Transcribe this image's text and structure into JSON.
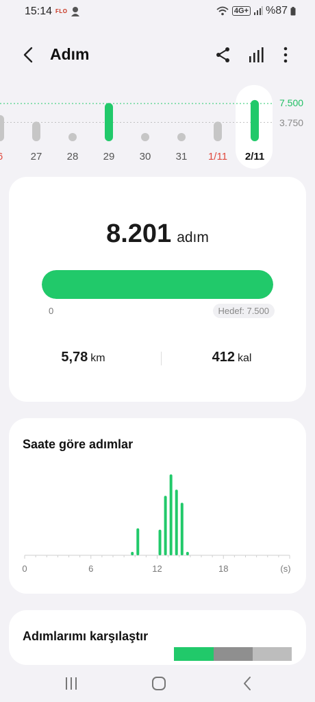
{
  "status_bar": {
    "time": "15:14",
    "carrier_badge": "FLO",
    "battery": "%87",
    "network": "4G+"
  },
  "header": {
    "title": "Adım",
    "back_icon": "chevron-left-icon",
    "actions": [
      "share-icon",
      "bar-chart-icon",
      "more-vertical-icon"
    ]
  },
  "date_strip": {
    "goal_line_label": "7.500",
    "half_line_label": "3.750",
    "days": [
      {
        "label": "6",
        "steps": 5200,
        "color": "#c6c6c6",
        "red": true,
        "selected": false
      },
      {
        "label": "27",
        "steps": 3900,
        "color": "#c6c6c6",
        "red": false,
        "selected": false
      },
      {
        "label": "28",
        "steps": 0,
        "color": "#c6c6c6",
        "red": false,
        "selected": false
      },
      {
        "label": "29",
        "steps": 7600,
        "color": "#21c96a",
        "red": false,
        "selected": false
      },
      {
        "label": "30",
        "steps": 0,
        "color": "#c6c6c6",
        "red": false,
        "selected": false
      },
      {
        "label": "31",
        "steps": 0,
        "color": "#c6c6c6",
        "red": false,
        "selected": false
      },
      {
        "label": "1/11",
        "steps": 3900,
        "color": "#c6c6c6",
        "red": true,
        "selected": false
      },
      {
        "label": "2/11",
        "steps": 8201,
        "color": "#21c96a",
        "red": false,
        "selected": true
      }
    ]
  },
  "summary": {
    "steps": "8.201",
    "steps_unit": "adım",
    "progress_fraction": 1.0,
    "progress_start": "0",
    "goal": "Hedef: 7.500",
    "distance_value": "5,78",
    "distance_unit": "km",
    "calories_value": "412",
    "calories_unit": "kal"
  },
  "hourly": {
    "title": "Saate göre adımlar",
    "axis_labels": [
      "0",
      "6",
      "12",
      "18",
      "(s)"
    ],
    "accent": "#21c96a"
  },
  "chart_data": {
    "type": "bar",
    "title": "Saate göre adımlar",
    "xlabel": "(s)",
    "ylabel": "",
    "x_ticks": [
      "0",
      "6",
      "12",
      "18"
    ],
    "xlim": [
      0,
      24
    ],
    "bars": [
      {
        "hour": 9.75,
        "value": 5
      },
      {
        "hour": 10.25,
        "value": 39
      },
      {
        "hour": 12.25,
        "value": 37
      },
      {
        "hour": 12.75,
        "value": 86
      },
      {
        "hour": 13.25,
        "value": 117
      },
      {
        "hour": 13.75,
        "value": 95
      },
      {
        "hour": 14.25,
        "value": 76
      },
      {
        "hour": 14.75,
        "value": 5
      }
    ]
  },
  "compare": {
    "title": "Adımlarımı karşılaştır",
    "segments": [
      "#21c96a",
      "#8f8f8f",
      "#bdbdbd"
    ]
  },
  "nav": {
    "recents": "recents-icon",
    "home": "home-icon",
    "back": "back-icon"
  }
}
